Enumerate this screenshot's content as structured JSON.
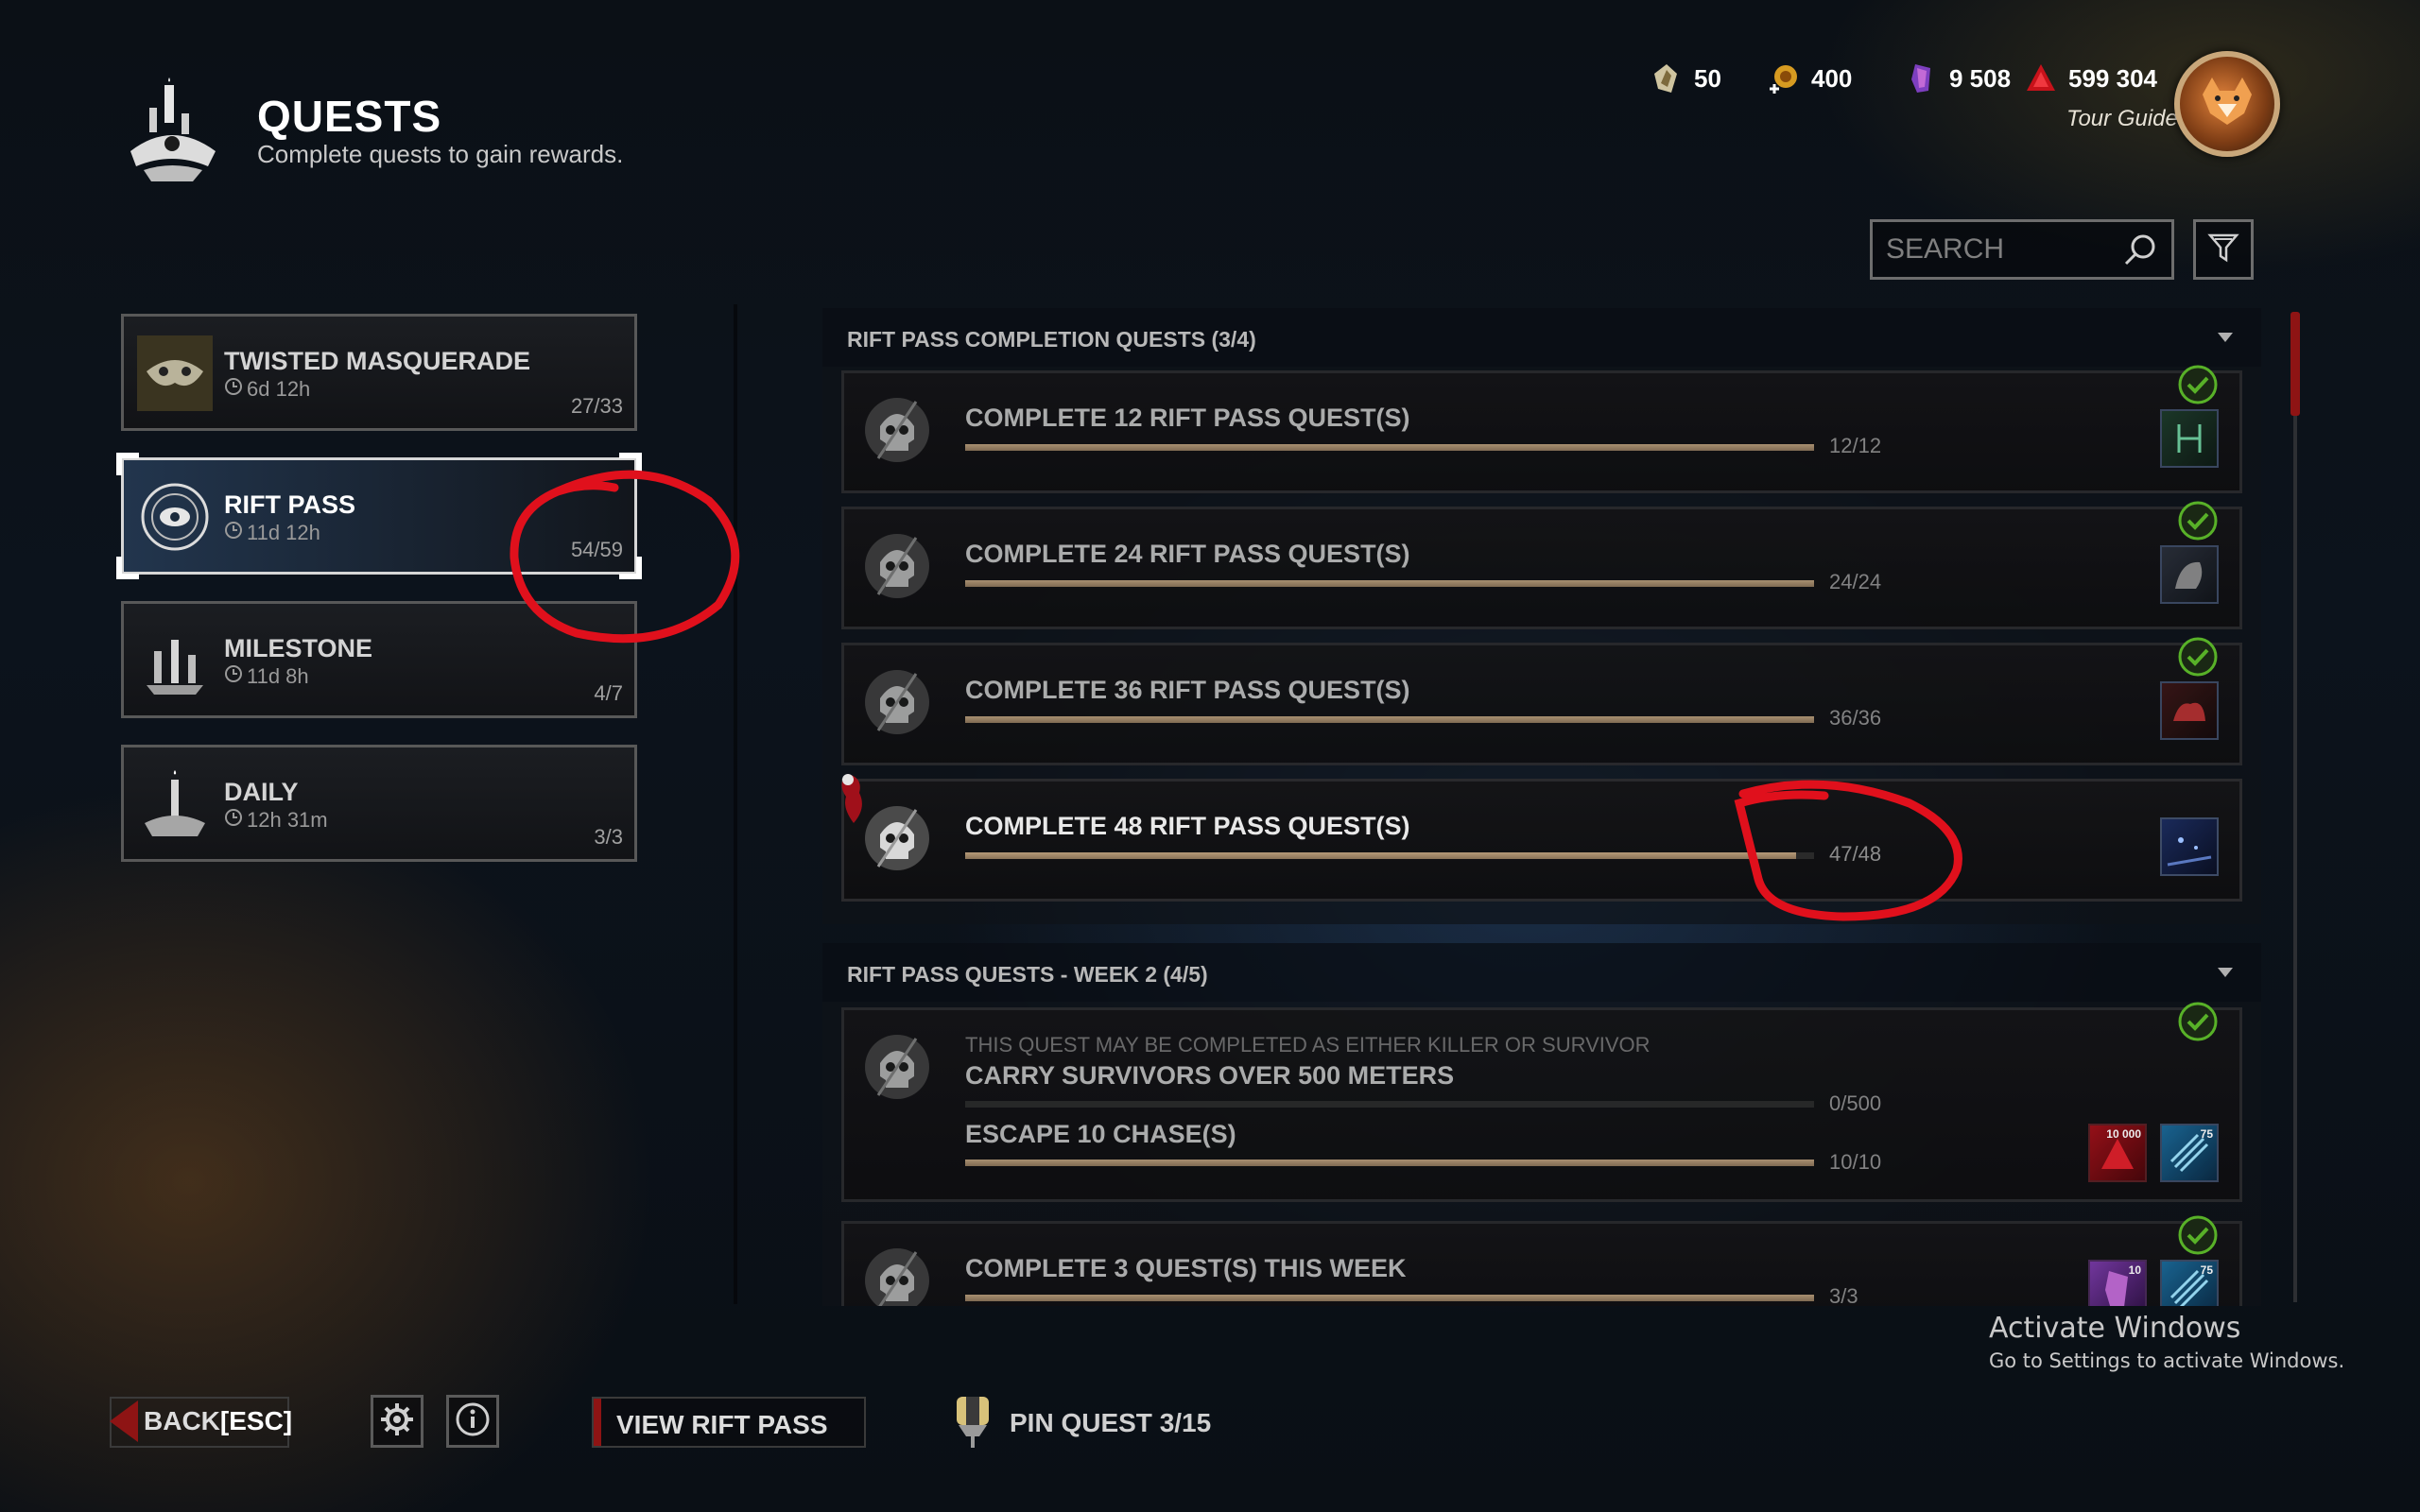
{
  "header": {
    "title": "QUESTS",
    "subtitle": "Complete quests to gain rewards.",
    "icon": "candle-altar-icon"
  },
  "currency": [
    {
      "icon": "rift-fragment-icon",
      "value": "50"
    },
    {
      "icon": "bloodpoint-plus-icon",
      "value": "400"
    },
    {
      "icon": "shard-icon",
      "value": "9 508"
    },
    {
      "icon": "bloodpoints-icon",
      "value": "599 304"
    }
  ],
  "profile": {
    "label": "Tour Guide"
  },
  "search": {
    "placeholder": "SEARCH"
  },
  "categories": [
    {
      "title": "TWISTED MASQUERADE",
      "time": "6d 12h",
      "count": "27/33",
      "active": false
    },
    {
      "title": "RIFT PASS",
      "time": "11d 12h",
      "count": "54/59",
      "active": true
    },
    {
      "title": "MILESTONE",
      "time": "11d 8h",
      "count": "4/7",
      "active": false
    },
    {
      "title": "DAILY",
      "time": "12h 31m",
      "count": "3/3",
      "active": false
    }
  ],
  "sections": [
    {
      "title": "RIFT PASS COMPLETION QUESTS (3/4)",
      "quests": [
        {
          "title": "COMPLETE 12 RIFT PASS QUEST(S)",
          "count": "12/12",
          "progress": 1.0,
          "completed": true
        },
        {
          "title": "COMPLETE 24 RIFT PASS QUEST(S)",
          "count": "24/24",
          "progress": 1.0,
          "completed": true
        },
        {
          "title": "COMPLETE 36 RIFT PASS QUEST(S)",
          "count": "36/36",
          "progress": 1.0,
          "completed": true
        },
        {
          "title": "COMPLETE 48 RIFT PASS QUEST(S)",
          "count": "47/48",
          "progress": 0.979,
          "completed": false
        }
      ]
    },
    {
      "title": "RIFT PASS QUESTS - WEEK 2 (4/5)",
      "quests": [
        {
          "note": "THIS QUEST MAY BE COMPLETED AS EITHER KILLER OR SURVIVOR",
          "title": "CARRY SURVIVORS OVER 500 METERS",
          "count": "0/500",
          "progress": 0.0,
          "title2": "ESCAPE 10 CHASE(S)",
          "count2": "10/10",
          "progress2": 1.0,
          "rewards": [
            "10 000",
            "75"
          ],
          "completed": true
        },
        {
          "title": "COMPLETE 3 QUEST(S) THIS WEEK",
          "count": "3/3",
          "progress": 1.0,
          "rewards": [
            "10",
            "75"
          ],
          "completed": true
        }
      ]
    }
  ],
  "footer": {
    "back_label": "BACK",
    "back_key": "[ESC]",
    "view_rift_label": "VIEW RIFT PASS",
    "pin_label": "PIN QUEST 3/15"
  },
  "watermark": {
    "title": "Activate Windows",
    "subtitle": "Go to Settings to activate Windows."
  },
  "colors": {
    "accent_red": "#8e1414",
    "check_green": "#5fbf2a",
    "progress_fill": "#b59a78",
    "annotation_red": "#e0101c"
  }
}
